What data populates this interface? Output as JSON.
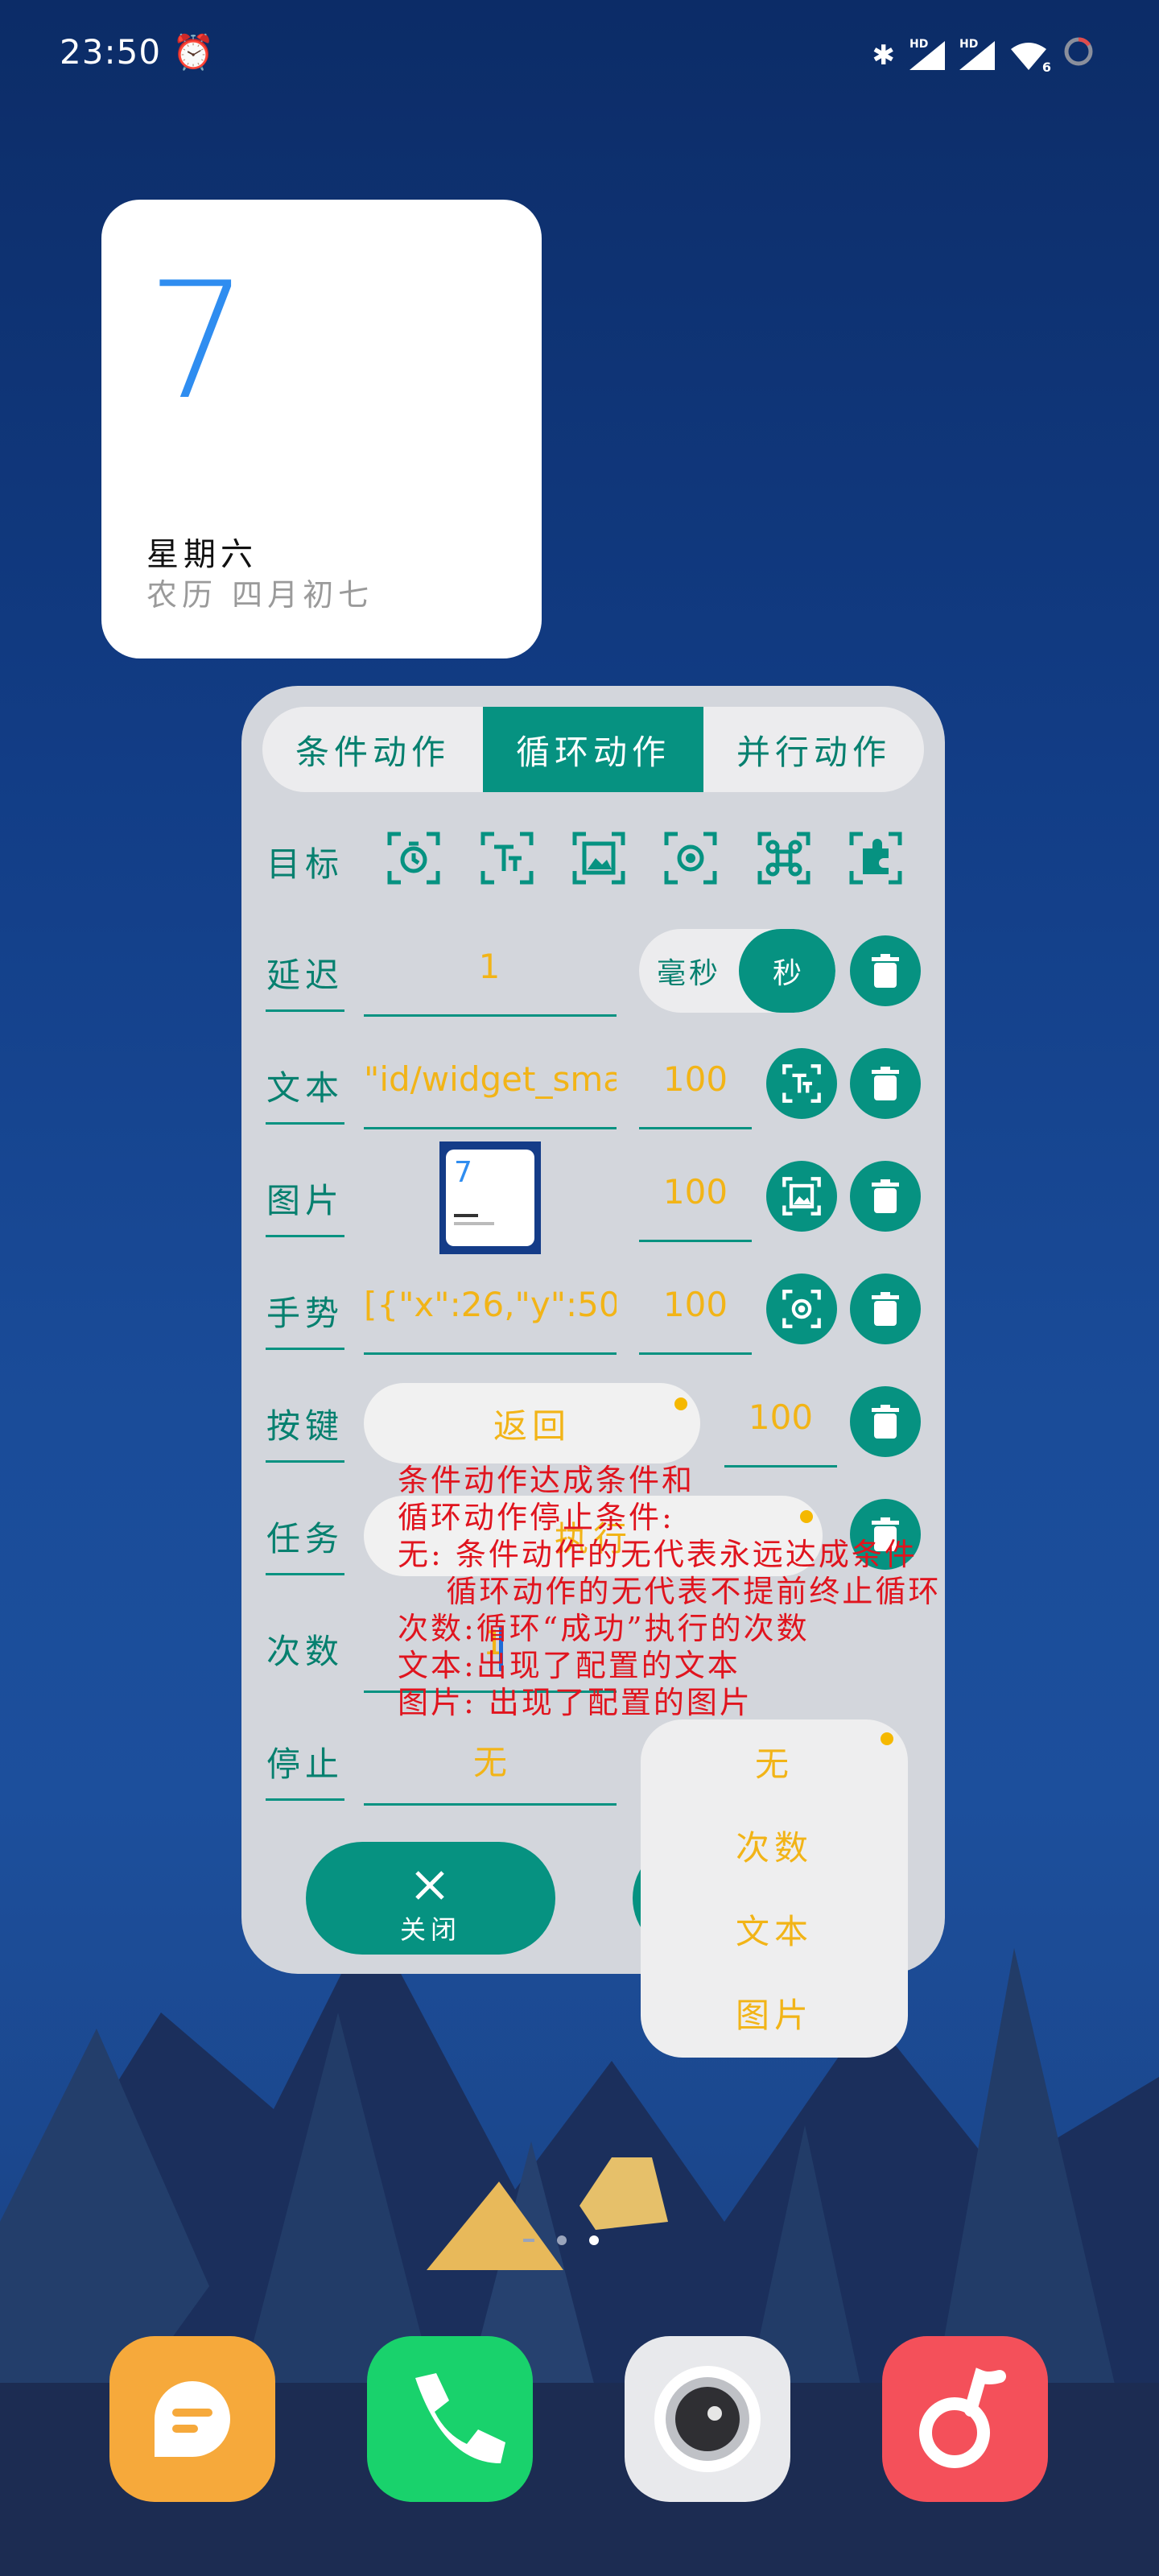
{
  "status_bar": {
    "time": "23:50",
    "signal_label_1": "HD",
    "signal_label_2": "HD",
    "wifi_badge": "6"
  },
  "calendar_widget": {
    "day": "7",
    "weekday": "星期六",
    "lunar": "农历 四月初七"
  },
  "dialog": {
    "tabs": [
      {
        "label": "条件动作",
        "active": false
      },
      {
        "label": "循环动作",
        "active": true
      },
      {
        "label": "并行动作",
        "active": false
      }
    ],
    "target": {
      "label": "目标",
      "icons": [
        "timer-target-icon",
        "text-target-icon",
        "image-target-icon",
        "gesture-target-icon",
        "key-target-icon",
        "plugin-target-icon"
      ]
    },
    "delay": {
      "label": "延迟",
      "value": "1",
      "unit_ms": "毫秒",
      "unit_s": "秒",
      "selected_unit": "秒"
    },
    "text": {
      "label": "文本",
      "value": "\"id/widget_sma",
      "similarity": "100"
    },
    "image": {
      "label": "图片",
      "thumb_day": "7",
      "similarity": "100"
    },
    "gesture": {
      "label": "手势",
      "value": "[{\"x\":26,\"y\":50},{",
      "similarity": "100"
    },
    "key": {
      "label": "按键",
      "value": "返回",
      "similarity": "100"
    },
    "task": {
      "label": "任务",
      "value": "执行"
    },
    "count": {
      "label": "次数",
      "value": "1"
    },
    "stop": {
      "label": "停止",
      "value": "无"
    },
    "close_label": "关闭"
  },
  "help_text": "条件动作达成条件和\n循环动作停止条件:\n无: 条件动作的无代表永远达成条件\n    循环动作的无代表不提前终止循环\n次数:循环“成功”执行的次数\n文本:出现了配置的文本\n图片: 出现了配置的图片",
  "stop_dropdown": {
    "options": [
      "无",
      "次数",
      "文本",
      "图片"
    ],
    "selected": "无"
  },
  "dock": [
    {
      "name": "messages",
      "color": "#f6a93b"
    },
    {
      "name": "phone",
      "color": "#19d26c"
    },
    {
      "name": "camera",
      "color": "#e8e9ec"
    },
    {
      "name": "music",
      "color": "#f4505a"
    }
  ],
  "colors": {
    "accent": "#069281",
    "value": "#f2b417",
    "help": "#e0141e"
  }
}
